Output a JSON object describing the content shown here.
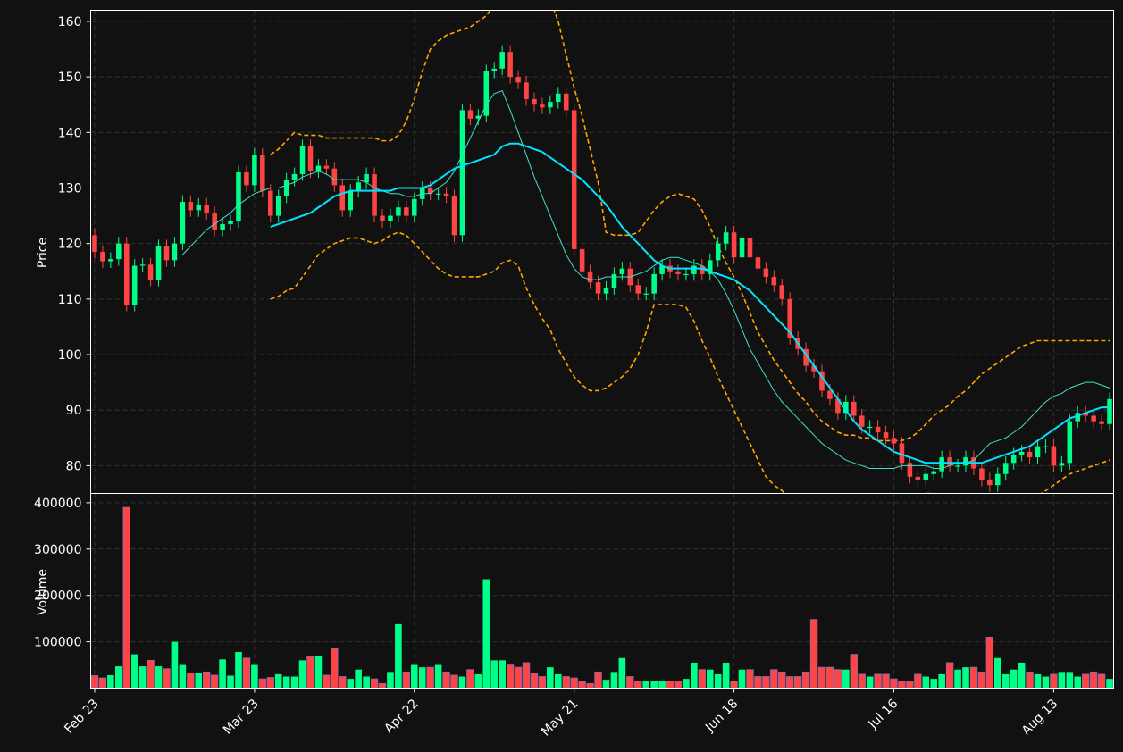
{
  "chart_data": {
    "type": "candlestick",
    "style": {
      "background": "#111111",
      "grid_color": "#333333",
      "axis_color": "#ffffff",
      "up_color": "#00ff88",
      "down_color": "#ff4444",
      "sma_fast_color": "#40e0d0",
      "sma_slow_color": "#00e5ff",
      "bollinger_color": "#ffa500",
      "grid": true
    },
    "price_panel": {
      "ylabel": "Price",
      "ylim": [
        75,
        162
      ],
      "yticks": [
        80,
        90,
        100,
        110,
        120,
        130,
        140,
        150,
        160
      ]
    },
    "volume_panel": {
      "ylabel": "Volume",
      "ylim": [
        0,
        420000
      ],
      "yticks": [
        100000,
        200000,
        300000,
        400000
      ],
      "ytick_labels": [
        "100000",
        "200000",
        "300000",
        "400000"
      ]
    },
    "x_axis": {
      "count": 128,
      "ticks": [
        {
          "index": 0,
          "label": "Feb 23"
        },
        {
          "index": 20,
          "label": "Mar 23"
        },
        {
          "index": 40,
          "label": "Apr 22"
        },
        {
          "index": 60,
          "label": "May 21"
        },
        {
          "index": 80,
          "label": "Jun 18"
        },
        {
          "index": 100,
          "label": "Jul 16"
        },
        {
          "index": 120,
          "label": "Aug 13"
        }
      ]
    },
    "close": [
      118.5,
      116.8,
      117.2,
      120.0,
      109.0,
      116.0,
      116.2,
      113.5,
      119.5,
      117.0,
      120.0,
      127.5,
      126.0,
      127.0,
      125.5,
      122.5,
      123.5,
      124.0,
      132.8,
      130.5,
      136.0,
      129.5,
      125.0,
      128.5,
      131.5,
      132.5,
      137.5,
      133.0,
      134.0,
      133.5,
      130.5,
      126.0,
      129.5,
      131.0,
      132.5,
      125.0,
      124.0,
      125.0,
      126.5,
      125.0,
      128.0,
      130.0,
      129.0,
      129.0,
      128.5,
      121.5,
      144.0,
      142.5,
      143.0,
      151.0,
      151.5,
      154.5,
      150.0,
      149.0,
      146.0,
      145.0,
      144.5,
      145.5,
      147.0,
      144.0,
      119.0,
      115.0,
      113.0,
      111.0,
      112.0,
      114.5,
      115.5,
      112.5,
      111.0,
      111.0,
      114.5,
      116.0,
      115.0,
      114.5,
      114.5,
      116.0,
      114.5,
      117.0,
      120.0,
      122.0,
      117.5,
      121.0,
      117.5,
      115.5,
      114.0,
      112.5,
      110.0,
      103.0,
      101.0,
      98.0,
      97.0,
      93.5,
      92.0,
      89.5,
      91.5,
      89.0,
      87.0,
      87.0,
      86.0,
      85.0,
      84.0,
      80.5,
      78.0,
      77.5,
      78.5,
      79.0,
      81.5,
      80.0,
      80.0,
      81.5,
      79.5,
      77.5,
      76.5,
      78.5,
      80.5,
      82.0,
      82.5,
      81.5,
      83.5,
      83.5,
      80.0,
      80.5,
      88.0,
      89.5,
      89.0,
      88.0,
      87.5,
      92.0
    ],
    "sma_fast": [
      null,
      null,
      null,
      null,
      null,
      null,
      null,
      null,
      null,
      null,
      null,
      118.0,
      119.5,
      121.0,
      122.5,
      123.5,
      124.5,
      125.5,
      127.0,
      128.0,
      129.0,
      129.5,
      130.0,
      130.0,
      130.5,
      131.0,
      132.0,
      132.5,
      133.0,
      132.5,
      131.5,
      131.5,
      131.5,
      131.5,
      131.0,
      130.0,
      129.5,
      129.0,
      129.0,
      128.5,
      128.5,
      129.0,
      129.0,
      130.0,
      131.0,
      133.0,
      136.0,
      139.0,
      142.0,
      145.0,
      147.0,
      147.5,
      144.0,
      140.0,
      136.0,
      132.0,
      128.5,
      125.0,
      121.5,
      118.0,
      115.5,
      114.0,
      113.5,
      113.5,
      114.0,
      114.0,
      114.0,
      114.0,
      114.5,
      115.0,
      116.0,
      117.0,
      117.5,
      117.5,
      117.0,
      116.5,
      116.0,
      115.0,
      113.5,
      111.0,
      108.0,
      104.5,
      101.0,
      98.5,
      96.0,
      93.5,
      91.5,
      90.0,
      88.5,
      87.0,
      85.5,
      84.0,
      83.0,
      82.0,
      81.0,
      80.5,
      80.0,
      79.5,
      79.5,
      79.5,
      79.5,
      80.0,
      80.0,
      80.0,
      80.0,
      79.5,
      79.5,
      80.0,
      80.5,
      80.5,
      81.0,
      82.5,
      84.0,
      84.5,
      85.0,
      86.0,
      87.0,
      88.5,
      90.0,
      91.5,
      92.5,
      93.0,
      94.0,
      94.5,
      95.0,
      95.0,
      94.5,
      94.0
    ],
    "sma_slow": [
      null,
      null,
      null,
      null,
      null,
      null,
      null,
      null,
      null,
      null,
      null,
      null,
      null,
      null,
      null,
      null,
      null,
      null,
      null,
      null,
      null,
      null,
      123.0,
      123.5,
      124.0,
      124.5,
      125.0,
      125.5,
      126.5,
      127.5,
      128.5,
      129.0,
      129.5,
      129.5,
      129.5,
      129.5,
      129.5,
      129.5,
      130.0,
      130.0,
      130.0,
      130.0,
      130.5,
      131.5,
      132.5,
      133.5,
      134.0,
      134.5,
      135.0,
      135.5,
      136.0,
      137.5,
      138.0,
      138.0,
      137.5,
      137.0,
      136.5,
      135.5,
      134.5,
      133.5,
      132.5,
      131.5,
      130.0,
      128.5,
      127.0,
      125.0,
      123.0,
      121.5,
      120.0,
      118.5,
      117.0,
      116.0,
      115.5,
      115.5,
      115.5,
      115.5,
      115.5,
      115.0,
      114.5,
      114.0,
      113.5,
      112.5,
      111.5,
      110.0,
      108.5,
      107.0,
      105.5,
      104.0,
      102.0,
      100.0,
      98.0,
      96.0,
      94.0,
      92.0,
      90.0,
      88.0,
      86.5,
      85.5,
      84.5,
      83.5,
      82.5,
      82.0,
      81.5,
      81.0,
      80.5,
      80.5,
      80.5,
      80.5,
      80.5,
      80.5,
      80.5,
      80.5,
      81.0,
      81.5,
      82.0,
      82.5,
      83.0,
      83.5,
      84.5,
      85.5,
      86.5,
      87.5,
      88.5,
      89.0,
      89.5,
      90.0,
      90.5,
      90.5
    ],
    "bb_upper": [
      null,
      null,
      null,
      null,
      null,
      null,
      null,
      null,
      null,
      null,
      null,
      null,
      null,
      null,
      null,
      null,
      null,
      null,
      null,
      null,
      null,
      null,
      136.0,
      137.0,
      138.5,
      140.0,
      139.5,
      139.5,
      139.5,
      139.0,
      139.0,
      139.0,
      139.0,
      139.0,
      139.0,
      139.0,
      138.5,
      138.5,
      139.5,
      142.0,
      146.0,
      151.0,
      155.0,
      156.5,
      157.5,
      158.0,
      158.5,
      159.0,
      160.0,
      161.0,
      163.0,
      165.0,
      166.0,
      167.0,
      168.0,
      168.0,
      167.0,
      164.0,
      160.0,
      154.0,
      148.0,
      143.0,
      137.0,
      131.0,
      122.0,
      121.5,
      121.5,
      121.5,
      122.0,
      124.0,
      126.0,
      127.5,
      128.5,
      129.0,
      128.5,
      128.0,
      126.0,
      123.0,
      119.5,
      116.5,
      114.0,
      111.0,
      107.5,
      104.0,
      101.5,
      99.0,
      97.0,
      95.0,
      93.0,
      91.5,
      89.5,
      88.0,
      87.0,
      86.0,
      85.5,
      85.5,
      85.0,
      85.0,
      84.5,
      84.5,
      84.5,
      84.5,
      85.0,
      86.0,
      87.5,
      89.0,
      90.0,
      91.0,
      92.5,
      93.5,
      95.0,
      96.5,
      97.5,
      98.5,
      99.5,
      100.5,
      101.5,
      102.0,
      102.5,
      102.5,
      102.5,
      102.5,
      102.5,
      102.5,
      102.5,
      102.5,
      102.5,
      102.5
    ],
    "bb_lower": [
      null,
      null,
      null,
      null,
      null,
      null,
      null,
      null,
      null,
      null,
      null,
      null,
      null,
      null,
      null,
      null,
      null,
      null,
      null,
      null,
      null,
      null,
      110.0,
      110.5,
      111.5,
      112.0,
      114.0,
      116.0,
      118.0,
      119.0,
      120.0,
      120.5,
      121.0,
      121.0,
      120.5,
      120.0,
      120.5,
      121.5,
      122.0,
      121.5,
      120.0,
      118.5,
      117.0,
      115.5,
      114.5,
      114.0,
      114.0,
      114.0,
      114.0,
      114.5,
      115.0,
      116.5,
      117.0,
      116.0,
      112.0,
      109.0,
      106.5,
      104.5,
      101.0,
      98.5,
      96.0,
      94.5,
      93.5,
      93.5,
      94.0,
      95.0,
      96.0,
      97.5,
      100.0,
      104.0,
      109.0,
      109.0,
      109.0,
      109.0,
      108.5,
      106.0,
      102.5,
      99.5,
      96.0,
      93.0,
      90.0,
      87.0,
      84.0,
      81.0,
      78.0,
      76.5,
      75.5,
      74.0,
      73.0,
      72.0,
      71.5,
      70.5,
      70.0,
      69.5,
      69.5,
      70.0,
      71.0,
      72.0,
      73.0,
      74.0,
      74.0,
      74.0,
      74.5,
      74.5,
      75.0,
      75.0,
      74.0,
      72.5,
      71.5,
      70.5,
      70.0,
      70.0,
      71.0,
      72.0,
      72.5,
      73.0,
      73.5,
      74.0,
      74.5,
      75.5,
      76.5,
      77.5,
      78.5,
      79.0,
      79.5,
      80.0,
      80.5,
      81.0
    ],
    "volume": [
      27000,
      22000,
      28000,
      47000,
      390000,
      73000,
      47000,
      60000,
      47000,
      42000,
      100000,
      50000,
      33000,
      33000,
      35000,
      28000,
      62000,
      27000,
      78000,
      65000,
      50000,
      20000,
      23000,
      30000,
      25000,
      25000,
      60000,
      68000,
      70000,
      28000,
      85000,
      25000,
      20000,
      40000,
      25000,
      20000,
      10000,
      35000,
      138000,
      35000,
      50000,
      45000,
      45000,
      50000,
      35000,
      28000,
      25000,
      40000,
      30000,
      235000,
      60000,
      60000,
      50000,
      45000,
      55000,
      32000,
      25000,
      45000,
      30000,
      25000,
      22000,
      15000,
      10000,
      35000,
      18000,
      35000,
      65000,
      25000,
      15000,
      15000,
      15000,
      15000,
      15000,
      15000,
      20000,
      55000,
      40000,
      40000,
      30000,
      55000,
      15000,
      40000,
      40000,
      25000,
      25000,
      40000,
      35000,
      25000,
      25000,
      35000,
      148000,
      45000,
      45000,
      40000,
      40000,
      73000,
      30000,
      25000,
      30000,
      30000,
      20000,
      15000,
      15000,
      30000,
      25000,
      20000,
      30000,
      55000,
      40000,
      45000,
      45000,
      35000,
      110000,
      65000,
      30000,
      40000,
      55000,
      35000,
      30000,
      25000,
      30000,
      35000,
      35000,
      25000,
      30000,
      35000,
      30000,
      20000
    ]
  }
}
